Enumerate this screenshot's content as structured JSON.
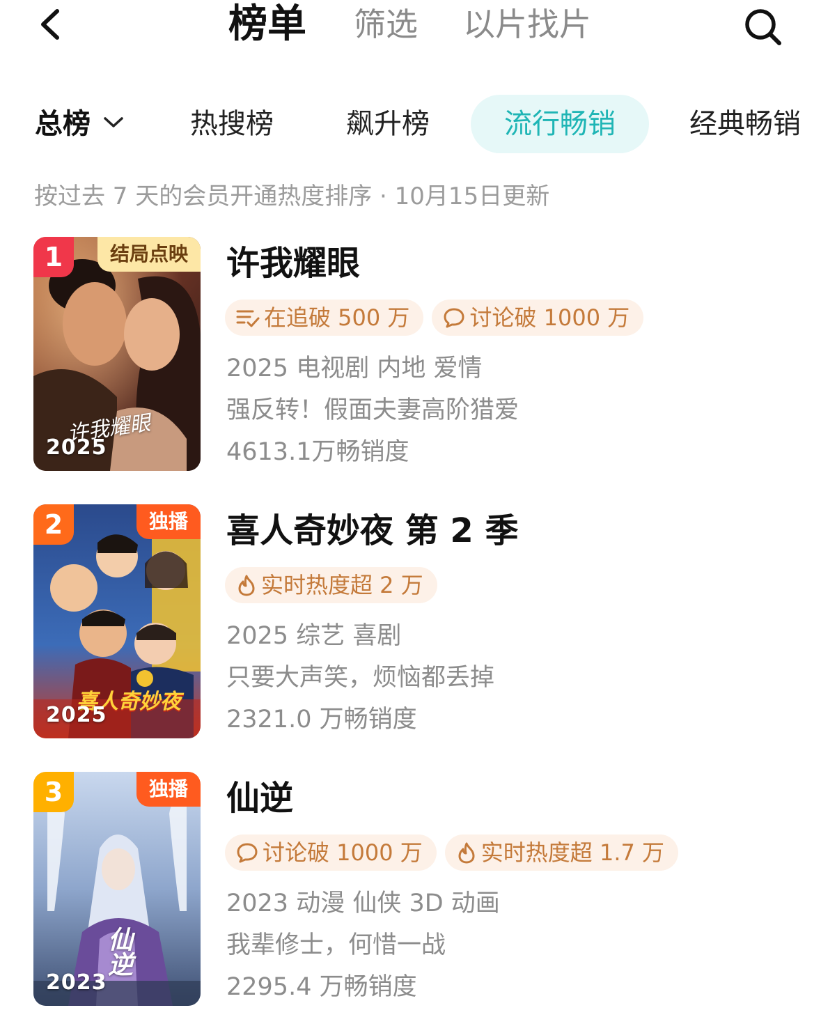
{
  "header": {
    "tabs": [
      {
        "label": "榜单",
        "active": true
      },
      {
        "label": "筛选",
        "active": false
      },
      {
        "label": "以片找片",
        "active": false
      }
    ],
    "back_icon": "chevron-left-icon",
    "search_icon": "search-icon"
  },
  "sub_tabs": [
    {
      "label": "总榜",
      "active": false,
      "has_dropdown": true
    },
    {
      "label": "热搜榜",
      "active": false
    },
    {
      "label": "飙升榜",
      "active": false
    },
    {
      "label": "流行畅销",
      "active": true
    },
    {
      "label": "经典畅销",
      "active": false
    }
  ],
  "subtitle": "按过去 7 天的会员开通热度排序 · 10月15日更新",
  "colors": {
    "accent_teal": "#1fb5b5",
    "accent_teal_bg": "#e6f8f8",
    "tag_text": "#c47a3a",
    "tag_bg": "#fdf1e8",
    "rank_1": "#f0374a",
    "rank_2": "#ff6a1a",
    "rank_3": "#ffb000"
  },
  "items": [
    {
      "rank": "1",
      "corner_tag": "结局点映",
      "poster_year": "2025",
      "poster_script": "许我耀眼",
      "title": "许我耀眼",
      "tags": [
        {
          "icon": "list-check-icon",
          "text": "在追破 500 万"
        },
        {
          "icon": "chat-bubble-icon",
          "text": "讨论破 1000 万"
        }
      ],
      "info": "2025 电视剧 内地 爱情",
      "tagline": "强反转！假面夫妻高阶猎爱",
      "sales": "4613.1万畅销度"
    },
    {
      "rank": "2",
      "corner_tag": "独播",
      "poster_year": "2025",
      "poster_script": "喜人奇妙夜",
      "title": "喜人奇妙夜 第 2 季",
      "tags": [
        {
          "icon": "flame-icon",
          "text": "实时热度超 2 万"
        }
      ],
      "info": "2025 综艺 喜剧",
      "tagline": "只要大声笑，烦恼都丢掉",
      "sales": "2321.0 万畅销度"
    },
    {
      "rank": "3",
      "corner_tag": "独播",
      "poster_year": "2023",
      "poster_script": "仙逆",
      "title": "仙逆",
      "tags": [
        {
          "icon": "chat-bubble-icon",
          "text": "讨论破 1000 万"
        },
        {
          "icon": "flame-icon",
          "text": "实时热度超 1.7 万"
        }
      ],
      "info": "2023 动漫 仙侠 3D 动画",
      "tagline": "我辈修士，何惜一战",
      "sales": "2295.4 万畅销度"
    }
  ]
}
